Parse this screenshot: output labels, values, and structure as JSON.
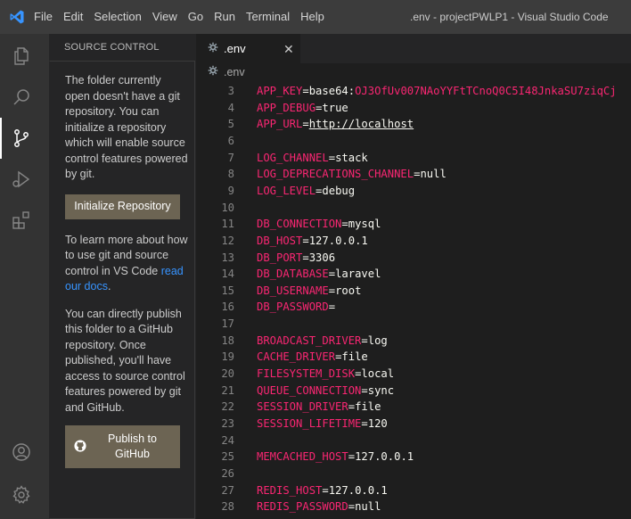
{
  "titlebar": {
    "menus": [
      "File",
      "Edit",
      "Selection",
      "View",
      "Go",
      "Run",
      "Terminal",
      "Help"
    ],
    "window_title": ".env - projectPWLP1 - Visual Studio Code"
  },
  "activity": [
    "explorer-icon",
    "search-icon",
    "source-control-icon",
    "run-debug-icon",
    "extensions-icon",
    "accounts-icon",
    "manage-gear-icon"
  ],
  "sidebar": {
    "header": "SOURCE CONTROL",
    "intro": "The folder currently open doesn't have a git repository. You can initialize a repository which will enable source control features powered by git.",
    "init_button": "Initialize Repository",
    "learn_prefix": "To learn more about how to use git and source control in VS Code ",
    "learn_link": "read our docs",
    "learn_suffix": ".",
    "publish_text": "You can directly publish this folder to a GitHub repository. Once published, you'll have access to source control features powered by git and GitHub.",
    "publish_button_line1": "Publish to",
    "publish_button_line2": "GitHub"
  },
  "editor": {
    "tab_label": ".env",
    "breadcrumb": ".env",
    "lines": [
      {
        "n": "3",
        "key": "APP_KEY",
        "val": "base64:OJ3OfUv007NAoYYFtTCnoQ0C5I48JnkaSU7ziqCj",
        "kind": "b64"
      },
      {
        "n": "4",
        "key": "APP_DEBUG",
        "val": "true",
        "kind": "plain"
      },
      {
        "n": "5",
        "key": "APP_URL",
        "val": "http://localhost",
        "kind": "url"
      },
      {
        "n": "6",
        "key": "",
        "val": "",
        "kind": "empty"
      },
      {
        "n": "7",
        "key": "LOG_CHANNEL",
        "val": "stack",
        "kind": "plain"
      },
      {
        "n": "8",
        "key": "LOG_DEPRECATIONS_CHANNEL",
        "val": "null",
        "kind": "plain"
      },
      {
        "n": "9",
        "key": "LOG_LEVEL",
        "val": "debug",
        "kind": "plain"
      },
      {
        "n": "10",
        "key": "",
        "val": "",
        "kind": "empty"
      },
      {
        "n": "11",
        "key": "DB_CONNECTION",
        "val": "mysql",
        "kind": "plain"
      },
      {
        "n": "12",
        "key": "DB_HOST",
        "val": "127.0.0.1",
        "kind": "plain"
      },
      {
        "n": "13",
        "key": "DB_PORT",
        "val": "3306",
        "kind": "plain"
      },
      {
        "n": "14",
        "key": "DB_DATABASE",
        "val": "laravel",
        "kind": "plain"
      },
      {
        "n": "15",
        "key": "DB_USERNAME",
        "val": "root",
        "kind": "plain"
      },
      {
        "n": "16",
        "key": "DB_PASSWORD",
        "val": "",
        "kind": "plain"
      },
      {
        "n": "17",
        "key": "",
        "val": "",
        "kind": "empty"
      },
      {
        "n": "18",
        "key": "BROADCAST_DRIVER",
        "val": "log",
        "kind": "plain"
      },
      {
        "n": "19",
        "key": "CACHE_DRIVER",
        "val": "file",
        "kind": "plain"
      },
      {
        "n": "20",
        "key": "FILESYSTEM_DISK",
        "val": "local",
        "kind": "plain"
      },
      {
        "n": "21",
        "key": "QUEUE_CONNECTION",
        "val": "sync",
        "kind": "plain"
      },
      {
        "n": "22",
        "key": "SESSION_DRIVER",
        "val": "file",
        "kind": "plain"
      },
      {
        "n": "23",
        "key": "SESSION_LIFETIME",
        "val": "120",
        "kind": "plain"
      },
      {
        "n": "24",
        "key": "",
        "val": "",
        "kind": "empty"
      },
      {
        "n": "25",
        "key": "MEMCACHED_HOST",
        "val": "127.0.0.1",
        "kind": "plain"
      },
      {
        "n": "26",
        "key": "",
        "val": "",
        "kind": "empty"
      },
      {
        "n": "27",
        "key": "REDIS_HOST",
        "val": "127.0.0.1",
        "kind": "plain"
      },
      {
        "n": "28",
        "key": "REDIS_PASSWORD",
        "val": "null",
        "kind": "plain"
      }
    ]
  },
  "colors": {
    "key": "#f92672",
    "value": "#f8f8f2",
    "line_number": "#858585",
    "link": "#3794ff",
    "button_bg": "#6c6453",
    "vscode_blue": "#3794ff"
  }
}
